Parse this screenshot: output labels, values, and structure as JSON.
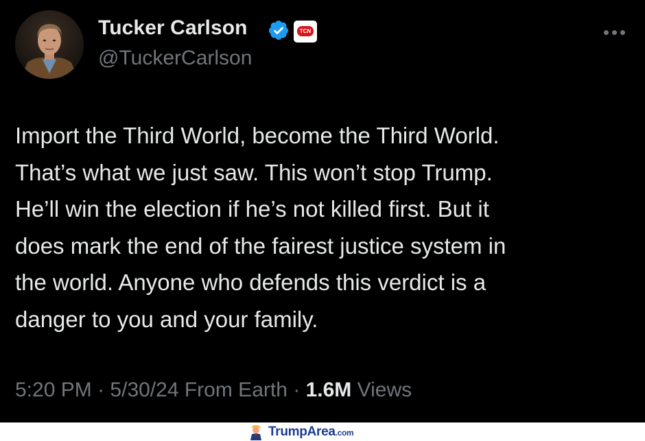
{
  "tweet": {
    "author": {
      "display_name": "Tucker Carlson",
      "handle": "@TuckerCarlson",
      "verified": true,
      "verified_color": "#1d9bf0",
      "affiliate_badge_text": "TCN",
      "affiliate_badge_color": "#d9141a"
    },
    "text": "Import the Third World, become the Third World.\nThat’s what we just saw. This won’t stop Trump.\nHe’ll win the election if he’s not killed first. But it\ndoes mark the end of the fairest justice system in\nthe world. Anyone who defends this verdict is a\ndanger to you and your family.",
    "time": "5:20 PM",
    "separator": "·",
    "date": "5/30/24",
    "source": "From Earth",
    "views_count": "1.6M",
    "views_label": "Views"
  },
  "icons": {
    "more": "more-horizontal-icon",
    "verified": "verified-badge-icon"
  },
  "footer": {
    "brand_main": "TrumpArea",
    "brand_tld": ".com"
  }
}
